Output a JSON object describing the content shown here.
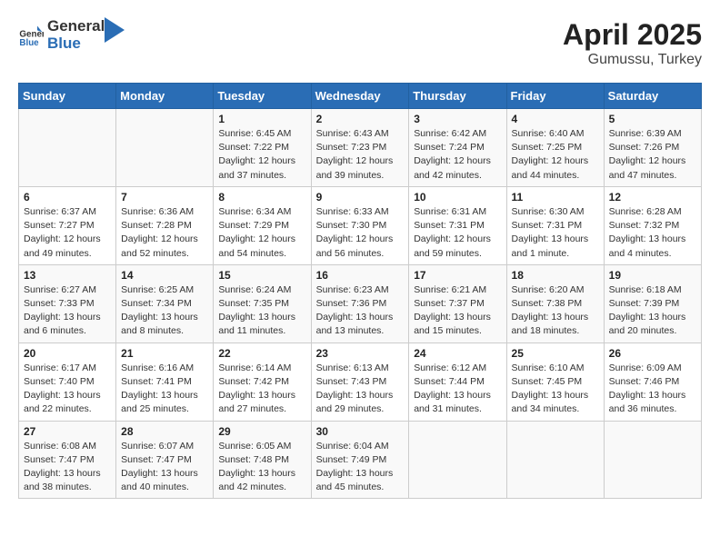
{
  "header": {
    "logo_general": "General",
    "logo_blue": "Blue",
    "month": "April 2025",
    "location": "Gumussu, Turkey"
  },
  "weekdays": [
    "Sunday",
    "Monday",
    "Tuesday",
    "Wednesday",
    "Thursday",
    "Friday",
    "Saturday"
  ],
  "weeks": [
    [
      {
        "day": "",
        "info": ""
      },
      {
        "day": "",
        "info": ""
      },
      {
        "day": "1",
        "info": "Sunrise: 6:45 AM\nSunset: 7:22 PM\nDaylight: 12 hours and 37 minutes."
      },
      {
        "day": "2",
        "info": "Sunrise: 6:43 AM\nSunset: 7:23 PM\nDaylight: 12 hours and 39 minutes."
      },
      {
        "day": "3",
        "info": "Sunrise: 6:42 AM\nSunset: 7:24 PM\nDaylight: 12 hours and 42 minutes."
      },
      {
        "day": "4",
        "info": "Sunrise: 6:40 AM\nSunset: 7:25 PM\nDaylight: 12 hours and 44 minutes."
      },
      {
        "day": "5",
        "info": "Sunrise: 6:39 AM\nSunset: 7:26 PM\nDaylight: 12 hours and 47 minutes."
      }
    ],
    [
      {
        "day": "6",
        "info": "Sunrise: 6:37 AM\nSunset: 7:27 PM\nDaylight: 12 hours and 49 minutes."
      },
      {
        "day": "7",
        "info": "Sunrise: 6:36 AM\nSunset: 7:28 PM\nDaylight: 12 hours and 52 minutes."
      },
      {
        "day": "8",
        "info": "Sunrise: 6:34 AM\nSunset: 7:29 PM\nDaylight: 12 hours and 54 minutes."
      },
      {
        "day": "9",
        "info": "Sunrise: 6:33 AM\nSunset: 7:30 PM\nDaylight: 12 hours and 56 minutes."
      },
      {
        "day": "10",
        "info": "Sunrise: 6:31 AM\nSunset: 7:31 PM\nDaylight: 12 hours and 59 minutes."
      },
      {
        "day": "11",
        "info": "Sunrise: 6:30 AM\nSunset: 7:31 PM\nDaylight: 13 hours and 1 minute."
      },
      {
        "day": "12",
        "info": "Sunrise: 6:28 AM\nSunset: 7:32 PM\nDaylight: 13 hours and 4 minutes."
      }
    ],
    [
      {
        "day": "13",
        "info": "Sunrise: 6:27 AM\nSunset: 7:33 PM\nDaylight: 13 hours and 6 minutes."
      },
      {
        "day": "14",
        "info": "Sunrise: 6:25 AM\nSunset: 7:34 PM\nDaylight: 13 hours and 8 minutes."
      },
      {
        "day": "15",
        "info": "Sunrise: 6:24 AM\nSunset: 7:35 PM\nDaylight: 13 hours and 11 minutes."
      },
      {
        "day": "16",
        "info": "Sunrise: 6:23 AM\nSunset: 7:36 PM\nDaylight: 13 hours and 13 minutes."
      },
      {
        "day": "17",
        "info": "Sunrise: 6:21 AM\nSunset: 7:37 PM\nDaylight: 13 hours and 15 minutes."
      },
      {
        "day": "18",
        "info": "Sunrise: 6:20 AM\nSunset: 7:38 PM\nDaylight: 13 hours and 18 minutes."
      },
      {
        "day": "19",
        "info": "Sunrise: 6:18 AM\nSunset: 7:39 PM\nDaylight: 13 hours and 20 minutes."
      }
    ],
    [
      {
        "day": "20",
        "info": "Sunrise: 6:17 AM\nSunset: 7:40 PM\nDaylight: 13 hours and 22 minutes."
      },
      {
        "day": "21",
        "info": "Sunrise: 6:16 AM\nSunset: 7:41 PM\nDaylight: 13 hours and 25 minutes."
      },
      {
        "day": "22",
        "info": "Sunrise: 6:14 AM\nSunset: 7:42 PM\nDaylight: 13 hours and 27 minutes."
      },
      {
        "day": "23",
        "info": "Sunrise: 6:13 AM\nSunset: 7:43 PM\nDaylight: 13 hours and 29 minutes."
      },
      {
        "day": "24",
        "info": "Sunrise: 6:12 AM\nSunset: 7:44 PM\nDaylight: 13 hours and 31 minutes."
      },
      {
        "day": "25",
        "info": "Sunrise: 6:10 AM\nSunset: 7:45 PM\nDaylight: 13 hours and 34 minutes."
      },
      {
        "day": "26",
        "info": "Sunrise: 6:09 AM\nSunset: 7:46 PM\nDaylight: 13 hours and 36 minutes."
      }
    ],
    [
      {
        "day": "27",
        "info": "Sunrise: 6:08 AM\nSunset: 7:47 PM\nDaylight: 13 hours and 38 minutes."
      },
      {
        "day": "28",
        "info": "Sunrise: 6:07 AM\nSunset: 7:47 PM\nDaylight: 13 hours and 40 minutes."
      },
      {
        "day": "29",
        "info": "Sunrise: 6:05 AM\nSunset: 7:48 PM\nDaylight: 13 hours and 42 minutes."
      },
      {
        "day": "30",
        "info": "Sunrise: 6:04 AM\nSunset: 7:49 PM\nDaylight: 13 hours and 45 minutes."
      },
      {
        "day": "",
        "info": ""
      },
      {
        "day": "",
        "info": ""
      },
      {
        "day": "",
        "info": ""
      }
    ]
  ]
}
